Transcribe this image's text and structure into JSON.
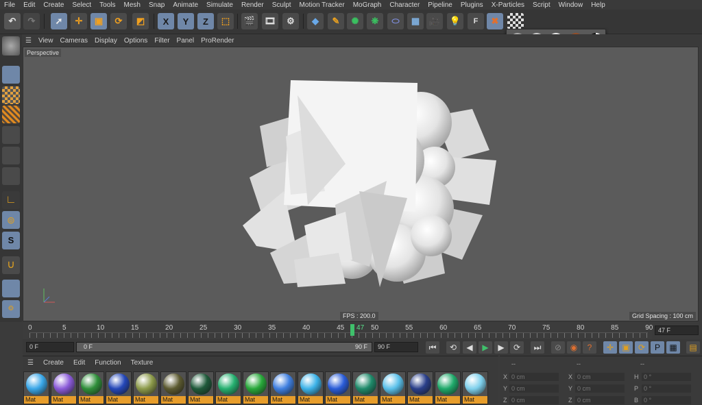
{
  "menubar": {
    "items": [
      "File",
      "Edit",
      "Create",
      "Select",
      "Tools",
      "Mesh",
      "Snap",
      "Animate",
      "Simulate",
      "Render",
      "Sculpt",
      "Motion Tracker",
      "MoGraph",
      "Character",
      "Pipeline",
      "Plugins",
      "X-Particles",
      "Script",
      "Window",
      "Help"
    ]
  },
  "toolbar": {
    "icons": [
      "undo-icon",
      "redo-icon",
      "select-arrow-icon",
      "move-icon",
      "scale-icon",
      "rotate-icon",
      "last-tool-icon",
      "x-axis-icon",
      "y-axis-icon",
      "z-axis-icon",
      "coordinate-system-icon",
      "render-view-icon",
      "render-picture-viewer-icon",
      "render-settings-icon",
      "cube-icon",
      "pen-icon",
      "subdivision-icon",
      "cloner-icon",
      "deformer-icon",
      "floor-icon",
      "camera-icon",
      "light-icon",
      "field-icon",
      "xparticles-icon",
      "checker-icon"
    ],
    "axis_labels": [
      "X",
      "Y",
      "Z"
    ],
    "field_label": "F"
  },
  "popup": {
    "icons": [
      "display-gouraud-icon",
      "display-quick-icon",
      "display-constant-icon",
      "display-hidden-line-icon",
      "display-lines-icon"
    ]
  },
  "viewport_menu": {
    "items": [
      "View",
      "Cameras",
      "Display",
      "Options",
      "Filter",
      "Panel",
      "ProRender"
    ]
  },
  "viewport": {
    "label": "Perspective",
    "fps": "FPS : 200.0",
    "grid_spacing": "Grid Spacing : 100 cm"
  },
  "timeline": {
    "ticks": [
      "0",
      "5",
      "10",
      "15",
      "20",
      "25",
      "30",
      "35",
      "40",
      "45",
      "50",
      "55",
      "60",
      "65",
      "70",
      "75",
      "80",
      "85",
      "90"
    ],
    "current_frame": "47",
    "current_frame_field": "47 F"
  },
  "transport": {
    "start_field": "0 F",
    "range_start": "0 F",
    "range_end": "90 F",
    "end_field": "90 F"
  },
  "material_manager": {
    "menu": [
      "Create",
      "Edit",
      "Function",
      "Texture"
    ],
    "materials": [
      {
        "label": "Mat",
        "color": "#3aa7e8"
      },
      {
        "label": "Mat",
        "color": "#8a5ad8"
      },
      {
        "label": "Mat",
        "color": "#2f8f3a"
      },
      {
        "label": "Mat",
        "color": "#2447b8"
      },
      {
        "label": "Mat",
        "color": "#8c9a4a"
      },
      {
        "label": "Mat",
        "color": "#5c5a30"
      },
      {
        "label": "Mat",
        "color": "#1f5a3a"
      },
      {
        "label": "Mat",
        "color": "#25b070"
      },
      {
        "label": "Mat",
        "color": "#28a83a"
      },
      {
        "label": "Mat",
        "color": "#3f7fe0"
      },
      {
        "label": "Mat",
        "color": "#3cb2e8"
      },
      {
        "label": "Mat",
        "color": "#2a5cd8"
      },
      {
        "label": "Mat",
        "color": "#1f8a6a"
      },
      {
        "label": "Mat",
        "color": "#5ac0ea"
      },
      {
        "label": "Mat",
        "color": "#2a3f8a"
      },
      {
        "label": "Mat",
        "color": "#1fa96a"
      },
      {
        "label": "Mat",
        "color": "#7ed0ec"
      }
    ]
  },
  "coordinates": {
    "rows": [
      {
        "a": "X",
        "a_val": "0 cm",
        "b": "X",
        "b_val": "0 cm",
        "c": "H",
        "c_val": "0 °"
      },
      {
        "a": "Y",
        "a_val": "0 cm",
        "b": "Y",
        "b_val": "0 cm",
        "c": "P",
        "c_val": "0 °"
      },
      {
        "a": "Z",
        "a_val": "0 cm",
        "b": "Z",
        "b_val": "0 cm",
        "c": "B",
        "c_val": "0 °"
      }
    ]
  },
  "colors": {
    "accent_orange": "#e79d2b",
    "selected_blue": "#6f87a8",
    "playhead_green": "#3fc06b"
  }
}
